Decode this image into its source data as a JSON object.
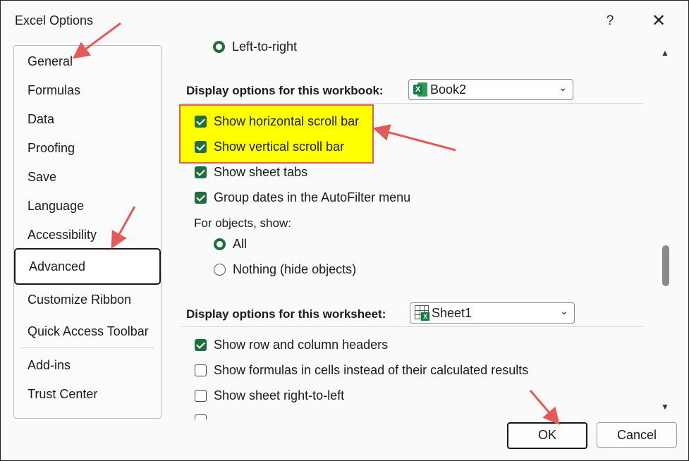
{
  "window": {
    "title": "Excel Options",
    "help": "?",
    "close": "✕"
  },
  "sidebar": {
    "items": [
      {
        "label": "General"
      },
      {
        "label": "Formulas"
      },
      {
        "label": "Data"
      },
      {
        "label": "Proofing"
      },
      {
        "label": "Save"
      },
      {
        "label": "Language"
      },
      {
        "label": "Accessibility"
      },
      {
        "label": "Advanced",
        "selected": true
      },
      {
        "label": "Customize Ribbon"
      },
      {
        "label": "Quick Access Toolbar"
      },
      {
        "label": "Add-ins"
      },
      {
        "label": "Trust Center"
      }
    ]
  },
  "content": {
    "left_to_right": "Left-to-right",
    "workbook_section": {
      "label": "Display options for this workbook:",
      "selected": "Book2",
      "options": [
        {
          "label": "Show horizontal scroll bar",
          "checked": true
        },
        {
          "label": "Show vertical scroll bar",
          "checked": true
        },
        {
          "label": "Show sheet tabs",
          "checked": true
        },
        {
          "label": "Group dates in the AutoFilter menu",
          "checked": true
        }
      ],
      "objects_label": "For objects, show:",
      "objects_all": "All",
      "objects_nothing": "Nothing (hide objects)"
    },
    "worksheet_section": {
      "label": "Display options for this worksheet:",
      "selected": "Sheet1",
      "options": [
        {
          "label": "Show row and column headers",
          "checked": true
        },
        {
          "label": "Show formulas in cells instead of their calculated results",
          "checked": false
        },
        {
          "label": "Show sheet right-to-left",
          "checked": false
        }
      ]
    }
  },
  "buttons": {
    "ok": "OK",
    "cancel": "Cancel"
  },
  "colors": {
    "accent": "#1f6e3e",
    "highlight": "#ffff00",
    "annotation_arrow": "#e35a5a"
  }
}
